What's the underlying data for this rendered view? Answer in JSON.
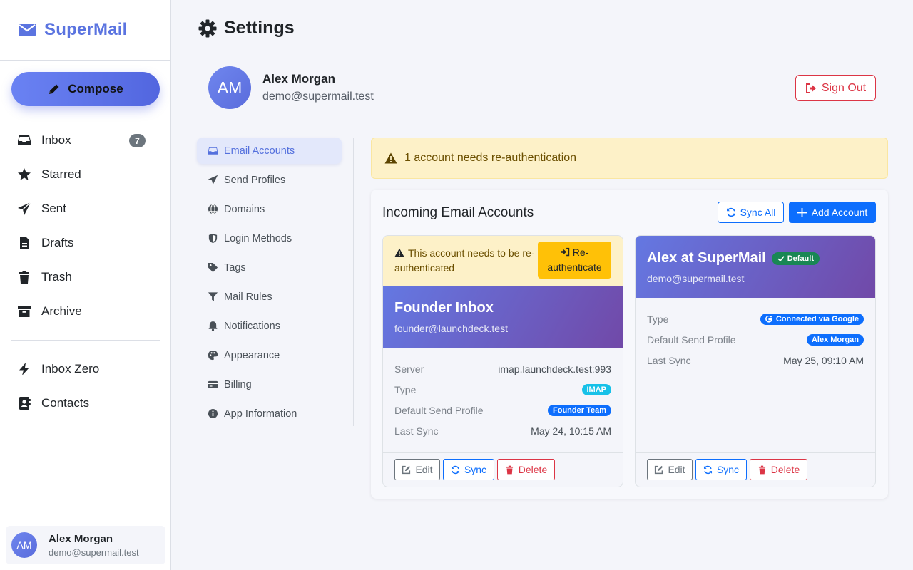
{
  "app": {
    "brand": "SuperMail"
  },
  "sidebar": {
    "compose_label": "Compose",
    "items": [
      {
        "label": "Inbox",
        "icon": "inbox-icon",
        "badge": "7"
      },
      {
        "label": "Starred",
        "icon": "star-icon"
      },
      {
        "label": "Sent",
        "icon": "paper-plane-icon"
      },
      {
        "label": "Drafts",
        "icon": "file-icon"
      },
      {
        "label": "Trash",
        "icon": "trash-icon"
      },
      {
        "label": "Archive",
        "icon": "archive-icon"
      }
    ],
    "extra_items": [
      {
        "label": "Inbox Zero",
        "icon": "bolt-icon"
      },
      {
        "label": "Contacts",
        "icon": "address-book-icon"
      }
    ],
    "user": {
      "initials": "AM",
      "name": "Alex Morgan",
      "email": "demo@supermail.test"
    }
  },
  "header": {
    "title": "Settings"
  },
  "profile": {
    "initials": "AM",
    "name": "Alex Morgan",
    "email": "demo@supermail.test",
    "signout_label": "Sign Out"
  },
  "settings_nav": {
    "items": [
      {
        "label": "Email Accounts",
        "icon": "inbox-icon",
        "active": true
      },
      {
        "label": "Send Profiles",
        "icon": "paper-plane-icon"
      },
      {
        "label": "Domains",
        "icon": "globe-icon"
      },
      {
        "label": "Login Methods",
        "icon": "shield-icon"
      },
      {
        "label": "Tags",
        "icon": "tag-icon"
      },
      {
        "label": "Mail Rules",
        "icon": "filter-icon"
      },
      {
        "label": "Notifications",
        "icon": "bell-icon"
      },
      {
        "label": "Appearance",
        "icon": "palette-icon"
      },
      {
        "label": "Billing",
        "icon": "credit-card-icon"
      },
      {
        "label": "App Information",
        "icon": "info-circle-icon"
      }
    ]
  },
  "alert": {
    "text": "1 account needs re-authentication"
  },
  "accounts_panel": {
    "title": "Incoming Email Accounts",
    "sync_all_label": "Sync All",
    "add_account_label": "Add Account",
    "labels": {
      "server": "Server",
      "type": "Type",
      "default_send_profile": "Default Send Profile",
      "last_sync": "Last Sync"
    },
    "actions": {
      "edit": "Edit",
      "sync": "Sync",
      "delete": "Delete"
    },
    "accounts": [
      {
        "warning": "This account needs to be re-authenticated",
        "reauth_label": "Re-authenticate",
        "name": "Founder Inbox",
        "email": "founder@launchdeck.test",
        "server": "imap.launchdeck.test:993",
        "type": "IMAP",
        "send_profile": "Founder Team",
        "last_sync": "May 24, 10:15 AM"
      },
      {
        "name": "Alex at SuperMail",
        "default_badge": "Default",
        "email": "demo@supermail.test",
        "type": "Connected via Google",
        "send_profile": "Alex Morgan",
        "last_sync": "May 25, 09:10 AM"
      }
    ]
  },
  "colors": {
    "accent": "#5b74e0",
    "primary": "#0d6efd",
    "danger": "#dc3545",
    "warning": "#ffc107",
    "success": "#198754"
  }
}
